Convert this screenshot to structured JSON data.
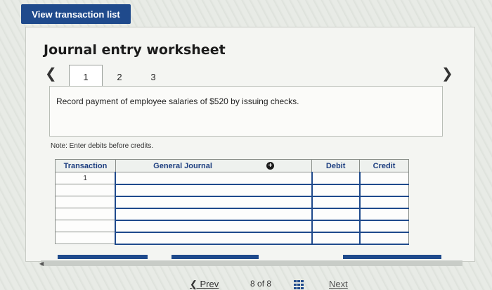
{
  "header": {
    "view_list_label": "View transaction list"
  },
  "worksheet": {
    "title": "Journal entry worksheet",
    "tabs": [
      "1",
      "2",
      "3"
    ],
    "active_tab": "1",
    "description": "Record payment of employee salaries of $520 by issuing checks.",
    "note": "Note: Enter debits before credits."
  },
  "journal": {
    "columns": [
      "Transaction",
      "General Journal",
      "Debit",
      "Credit"
    ],
    "rows": [
      {
        "transaction": "1",
        "account": "",
        "debit": "",
        "credit": ""
      },
      {
        "transaction": "",
        "account": "",
        "debit": "",
        "credit": ""
      },
      {
        "transaction": "",
        "account": "",
        "debit": "",
        "credit": ""
      },
      {
        "transaction": "",
        "account": "",
        "debit": "",
        "credit": ""
      },
      {
        "transaction": "",
        "account": "",
        "debit": "",
        "credit": ""
      },
      {
        "transaction": "",
        "account": "",
        "debit": "",
        "credit": ""
      }
    ]
  },
  "pager": {
    "prev_label": "Prev",
    "current": "8",
    "of_label": "of",
    "total": "8",
    "next_label": "Next"
  },
  "colors": {
    "accent": "#1f4a8c",
    "header_text": "#1e3f80"
  },
  "icons": {
    "prev": "chevron-left-icon",
    "next": "chevron-right-icon",
    "add_row": "plus-circle-icon",
    "grid": "grid-icon"
  }
}
